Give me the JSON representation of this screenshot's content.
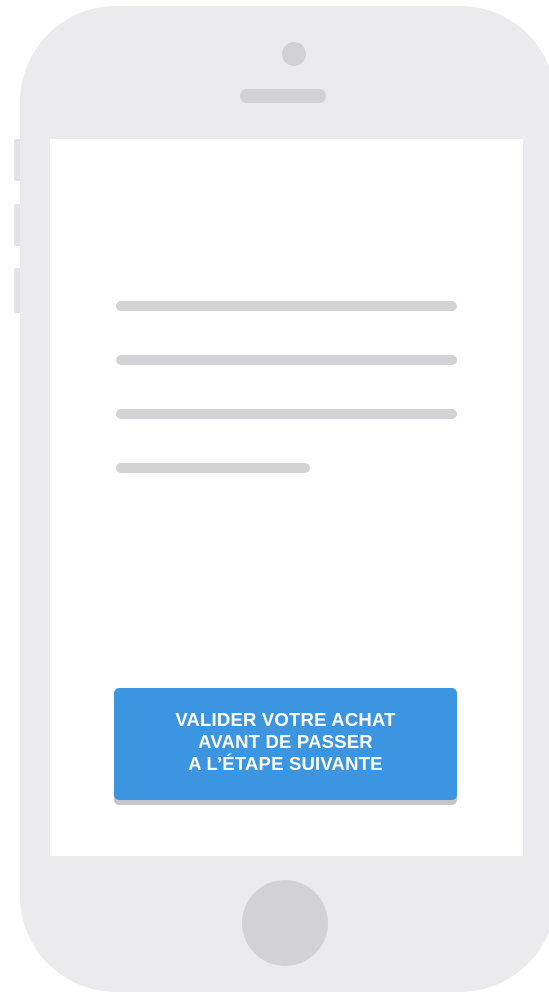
{
  "colors": {
    "device_body": "#ebebed",
    "device_details": "#d2d2d5",
    "screen_background": "#ffffff",
    "placeholder_line": "#d3d3d5",
    "button_background": "#3c95e0",
    "button_shadow": "#c6c6c9",
    "button_text": "#ffffff"
  },
  "device": {
    "type": "smartphone mockup",
    "icons": [
      "camera-icon",
      "speaker-icon",
      "home-button-icon"
    ]
  },
  "screen": {
    "placeholder_lines": 4,
    "cta": {
      "lines": [
        "VALIDER VOTRE ACHAT",
        "AVANT DE PASSER",
        "A L’ÉTAPE SUIVANTE"
      ]
    }
  }
}
